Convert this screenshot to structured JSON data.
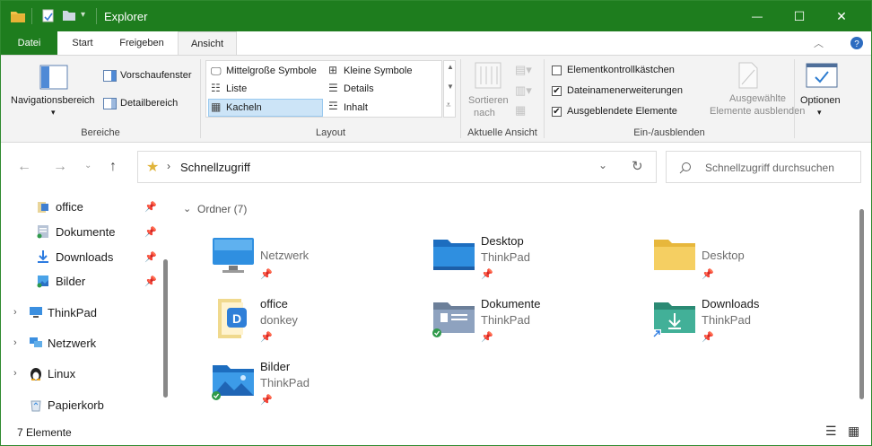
{
  "window": {
    "title": "Explorer",
    "accent": "#1e7d1e"
  },
  "controls": {
    "minimize": "—",
    "maximize": "☐",
    "close": "✕"
  },
  "tabs": [
    "Datei",
    "Start",
    "Freigeben",
    "Ansicht"
  ],
  "ribbon": {
    "bereiche": {
      "label": "Bereiche",
      "navigation": "Navigationsbereich",
      "preview": "Vorschaufenster",
      "details": "Detailbereich"
    },
    "layout": {
      "label": "Layout",
      "items": [
        "Mittelgroße Symbole",
        "Kleine Symbole",
        "Liste",
        "Details",
        "Kacheln",
        "Inhalt"
      ]
    },
    "current_view": {
      "label": "Aktuelle Ansicht",
      "sort_line1": "Sortieren",
      "sort_line2": "nach"
    },
    "show_hide": {
      "label": "Ein-/ausblenden",
      "checkboxes": [
        {
          "label": "Elementkontrollkästchen",
          "checked": false
        },
        {
          "label": "Dateinamenerweiterungen",
          "checked": true
        },
        {
          "label": "Ausgeblendete Elemente",
          "checked": true
        }
      ],
      "hide_selected_line1": "Ausgewählte",
      "hide_selected_line2": "Elemente ausblenden"
    },
    "options": "Optionen"
  },
  "address": {
    "location": "Schnellzugriff",
    "search_placeholder": "Schnellzugriff durchsuchen"
  },
  "nav_pane": {
    "quick": [
      {
        "label": "office",
        "icon": "office-folder-icon"
      },
      {
        "label": "Dokumente",
        "icon": "documents-icon"
      },
      {
        "label": "Downloads",
        "icon": "downloads-icon"
      },
      {
        "label": "Bilder",
        "icon": "pictures-icon"
      }
    ],
    "roots": [
      {
        "label": "ThinkPad",
        "icon": "computer-icon"
      },
      {
        "label": "Netzwerk",
        "icon": "network-icon"
      },
      {
        "label": "Linux",
        "icon": "linux-penguin-icon"
      },
      {
        "label": "Papierkorb",
        "icon": "recycle-bin-icon"
      }
    ]
  },
  "content": {
    "group_header": "Ordner (7)",
    "tiles": [
      {
        "name": "",
        "sub": "Netzwerk",
        "icon": "monitor-icon"
      },
      {
        "name": "Desktop",
        "sub": "ThinkPad",
        "icon": "desktop-folder-icon"
      },
      {
        "name": "",
        "sub": "Desktop",
        "icon": "yellow-folder-icon"
      },
      {
        "name": "office",
        "sub": "donkey",
        "icon": "office-folder-icon"
      },
      {
        "name": "Dokumente",
        "sub": "ThinkPad",
        "icon": "documents-folder-icon"
      },
      {
        "name": "Downloads",
        "sub": "ThinkPad",
        "icon": "downloads-folder-icon"
      },
      {
        "name": "Bilder",
        "sub": "ThinkPad",
        "icon": "pictures-folder-icon"
      }
    ]
  },
  "status": {
    "count": "7 Elemente"
  }
}
